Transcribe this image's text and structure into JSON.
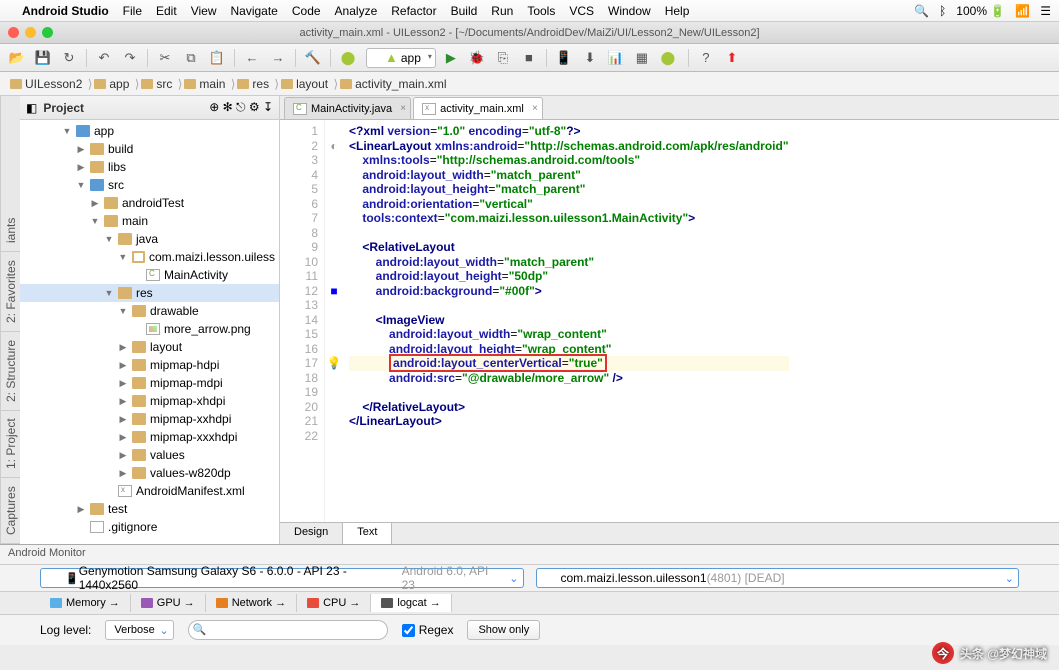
{
  "menubar": {
    "apple": "",
    "app": "Android Studio",
    "items": [
      "File",
      "Edit",
      "View",
      "Navigate",
      "Code",
      "Analyze",
      "Refactor",
      "Build",
      "Run",
      "Tools",
      "VCS",
      "Window",
      "Help"
    ],
    "battery": "100%"
  },
  "titlebar": {
    "title": "activity_main.xml - UILesson2 - [~/Documents/AndroidDev/MaiZi/UI/Lesson2_New/UILesson2]"
  },
  "toolbar": {
    "runconfig": "app"
  },
  "breadcrumb": [
    "UILesson2",
    "app",
    "src",
    "main",
    "res",
    "layout",
    "activity_main.xml"
  ],
  "leftstrip": [
    "Captures",
    "1: Project",
    "2: Structure",
    "2: Favorites",
    "iants"
  ],
  "projpanel": {
    "title": "Project"
  },
  "tree": [
    {
      "d": 3,
      "a": "open",
      "i": "folderblue",
      "t": "app"
    },
    {
      "d": 4,
      "a": "closed",
      "i": "folder",
      "t": "build"
    },
    {
      "d": 4,
      "a": "closed",
      "i": "folder",
      "t": "libs"
    },
    {
      "d": 4,
      "a": "open",
      "i": "folderblue",
      "t": "src"
    },
    {
      "d": 5,
      "a": "closed",
      "i": "folder",
      "t": "androidTest"
    },
    {
      "d": 5,
      "a": "open",
      "i": "folder",
      "t": "main"
    },
    {
      "d": 6,
      "a": "open",
      "i": "folder",
      "t": "java"
    },
    {
      "d": 7,
      "a": "open",
      "i": "pkg",
      "t": "com.maizi.lesson.uiless"
    },
    {
      "d": 8,
      "a": "none",
      "i": "java",
      "t": "MainActivity"
    },
    {
      "d": 6,
      "a": "open",
      "i": "folder",
      "t": "res",
      "sel": true
    },
    {
      "d": 7,
      "a": "open",
      "i": "folder",
      "t": "drawable"
    },
    {
      "d": 8,
      "a": "none",
      "i": "png",
      "t": "more_arrow.png"
    },
    {
      "d": 7,
      "a": "closed",
      "i": "folder",
      "t": "layout"
    },
    {
      "d": 7,
      "a": "closed",
      "i": "folder",
      "t": "mipmap-hdpi"
    },
    {
      "d": 7,
      "a": "closed",
      "i": "folder",
      "t": "mipmap-mdpi"
    },
    {
      "d": 7,
      "a": "closed",
      "i": "folder",
      "t": "mipmap-xhdpi"
    },
    {
      "d": 7,
      "a": "closed",
      "i": "folder",
      "t": "mipmap-xxhdpi"
    },
    {
      "d": 7,
      "a": "closed",
      "i": "folder",
      "t": "mipmap-xxxhdpi"
    },
    {
      "d": 7,
      "a": "closed",
      "i": "folder",
      "t": "values"
    },
    {
      "d": 7,
      "a": "closed",
      "i": "folder",
      "t": "values-w820dp"
    },
    {
      "d": 6,
      "a": "none",
      "i": "xml",
      "t": "AndroidManifest.xml"
    },
    {
      "d": 4,
      "a": "closed",
      "i": "folder",
      "t": "test"
    },
    {
      "d": 4,
      "a": "none",
      "i": "file",
      "t": ".gitignore"
    }
  ],
  "tabs": [
    {
      "label": "MainActivity.java",
      "icon": "java",
      "active": false
    },
    {
      "label": "activity_main.xml",
      "icon": "xml",
      "active": true
    }
  ],
  "code_lines": [
    {
      "n": 1,
      "html": "<span class='kw'>&lt;?</span><span class='tag'>xml</span> <span class='attr'>version</span>=<span class='str'>\"1.0\"</span> <span class='attr'>encoding</span>=<span class='str'>\"utf-8\"</span><span class='kw'>?&gt;</span>"
    },
    {
      "n": 2,
      "mark": "◐",
      "html": "<span class='kw'>&lt;</span><span class='tag'>LinearLayout</span> <span class='attr'>xmlns:android</span>=<span class='str'>\"http://schemas.android.com/apk/res/android\"</span>"
    },
    {
      "n": 3,
      "html": "    <span class='attr'>xmlns:tools</span>=<span class='str'>\"http://schemas.android.com/tools\"</span>"
    },
    {
      "n": 4,
      "html": "    <span class='attr'>android:layout_width</span>=<span class='str'>\"match_parent\"</span>"
    },
    {
      "n": 5,
      "html": "    <span class='attr'>android:layout_height</span>=<span class='str'>\"match_parent\"</span>"
    },
    {
      "n": 6,
      "html": "    <span class='attr'>android:orientation</span>=<span class='str'>\"vertical\"</span>"
    },
    {
      "n": 7,
      "html": "    <span class='attr'>tools:context</span>=<span class='str'>\"com.maizi.lesson.uilesson1.MainActivity\"</span><span class='kw'>&gt;</span>"
    },
    {
      "n": 8,
      "html": ""
    },
    {
      "n": 9,
      "html": "    <span class='kw'>&lt;</span><span class='tag'>RelativeLayout</span>"
    },
    {
      "n": 10,
      "html": "        <span class='attr'>android:layout_width</span>=<span class='str'>\"match_parent\"</span>"
    },
    {
      "n": 11,
      "html": "        <span class='attr'>android:layout_height</span>=<span class='str'>\"50dp\"</span>"
    },
    {
      "n": 12,
      "mark": "■",
      "html": "        <span class='attr'>android:background</span>=<span class='str'>\"#00f\"</span><span class='kw'>&gt;</span>"
    },
    {
      "n": 13,
      "html": ""
    },
    {
      "n": 14,
      "html": "        <span class='kw'>&lt;</span><span class='tag'>ImageView</span>"
    },
    {
      "n": 15,
      "html": "            <span class='attr'>android:layout_width</span>=<span class='str'>\"wrap_content\"</span>"
    },
    {
      "n": 16,
      "html": "            <span class='attr'>android:layout_height</span>=<span class='str'>\"wrap_content\"</span>"
    },
    {
      "n": 17,
      "hl": true,
      "mark": "💡",
      "html": "            <span class='redbox'><span class='attr'>android:layout_centerVertical</span>=<span class='str'>\"true\"</span></span>"
    },
    {
      "n": 18,
      "html": "            <span class='attr'>android:src</span>=<span class='str'>\"@drawable/more_arrow\"</span> <span class='kw'>/&gt;</span>"
    },
    {
      "n": 19,
      "html": ""
    },
    {
      "n": 20,
      "html": "    <span class='kw'>&lt;/</span><span class='tag'>RelativeLayout</span><span class='kw'>&gt;</span>"
    },
    {
      "n": 21,
      "html": "<span class='kw'>&lt;/</span><span class='tag'>LinearLayout</span><span class='kw'>&gt;</span>"
    },
    {
      "n": 22,
      "html": ""
    }
  ],
  "bottomtabs": [
    {
      "label": "Design"
    },
    {
      "label": "Text",
      "active": true
    }
  ],
  "monitor": {
    "title": "Android Monitor",
    "device_prefix": "Genymotion Samsung Galaxy S6 - 6.0.0 - API 23 - 1440x2560 ",
    "device_gray": "Android 6.0, API 23",
    "process_prefix": "com.maizi.lesson.uilesson1 ",
    "process_gray": "(4801) [DEAD]",
    "tabs": [
      {
        "l": "Memory",
        "c": "#5bb0e8"
      },
      {
        "l": "GPU",
        "c": "#9b59b6"
      },
      {
        "l": "Network",
        "c": "#e67e22"
      },
      {
        "l": "CPU",
        "c": "#e74c3c"
      },
      {
        "l": "logcat",
        "c": "#555",
        "active": true
      }
    ],
    "loglevel_label": "Log level:",
    "loglevel": "Verbose",
    "regex": "Regex",
    "showonly": "Show only"
  },
  "watermark": "头条 @梦幻神域"
}
